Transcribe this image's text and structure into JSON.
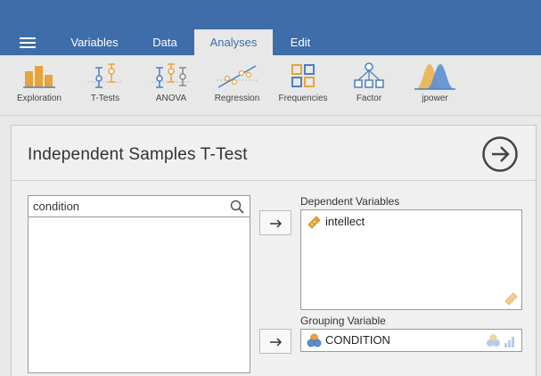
{
  "menu": {
    "tabs": [
      {
        "label": "Variables"
      },
      {
        "label": "Data"
      },
      {
        "label": "Analyses",
        "active": true
      },
      {
        "label": "Edit"
      }
    ]
  },
  "ribbon": {
    "buttons": [
      {
        "label": "Exploration",
        "icon": "exploration-icon"
      },
      {
        "label": "T-Tests",
        "icon": "ttests-icon"
      },
      {
        "label": "ANOVA",
        "icon": "anova-icon"
      },
      {
        "label": "Regression",
        "icon": "regression-icon"
      },
      {
        "label": "Frequencies",
        "icon": "frequencies-icon"
      },
      {
        "label": "Factor",
        "icon": "factor-icon"
      },
      {
        "label": "jpower",
        "icon": "jpower-icon"
      }
    ]
  },
  "analysis": {
    "title": "Independent Samples T-Test"
  },
  "search": {
    "value": "condition"
  },
  "dependent": {
    "label": "Dependent Variables",
    "items": [
      {
        "name": "intellect",
        "type": "continuous"
      }
    ]
  },
  "grouping": {
    "label": "Grouping Variable",
    "value": "CONDITION",
    "type": "nominal"
  },
  "colors": {
    "topbar": "#3e6da9",
    "accent": "#e8a33a",
    "ribbon_blue": "#4a7fc1"
  }
}
